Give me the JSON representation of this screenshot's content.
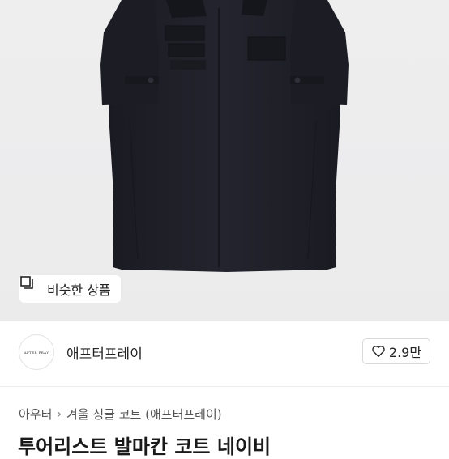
{
  "hero": {
    "similar_button_label": "비슷한 상품",
    "background_color": "#ededee",
    "coat_color": "#1e1f27"
  },
  "seller": {
    "avatar_text": "AFTER PRAY",
    "name": "애프터프레이",
    "likes": "2.9만"
  },
  "breadcrumb": {
    "items": [
      "아우터",
      "겨울 싱글 코트 (애프터프레이)"
    ]
  },
  "product": {
    "title": "투어리스트 발마칸 코트 네이비"
  }
}
